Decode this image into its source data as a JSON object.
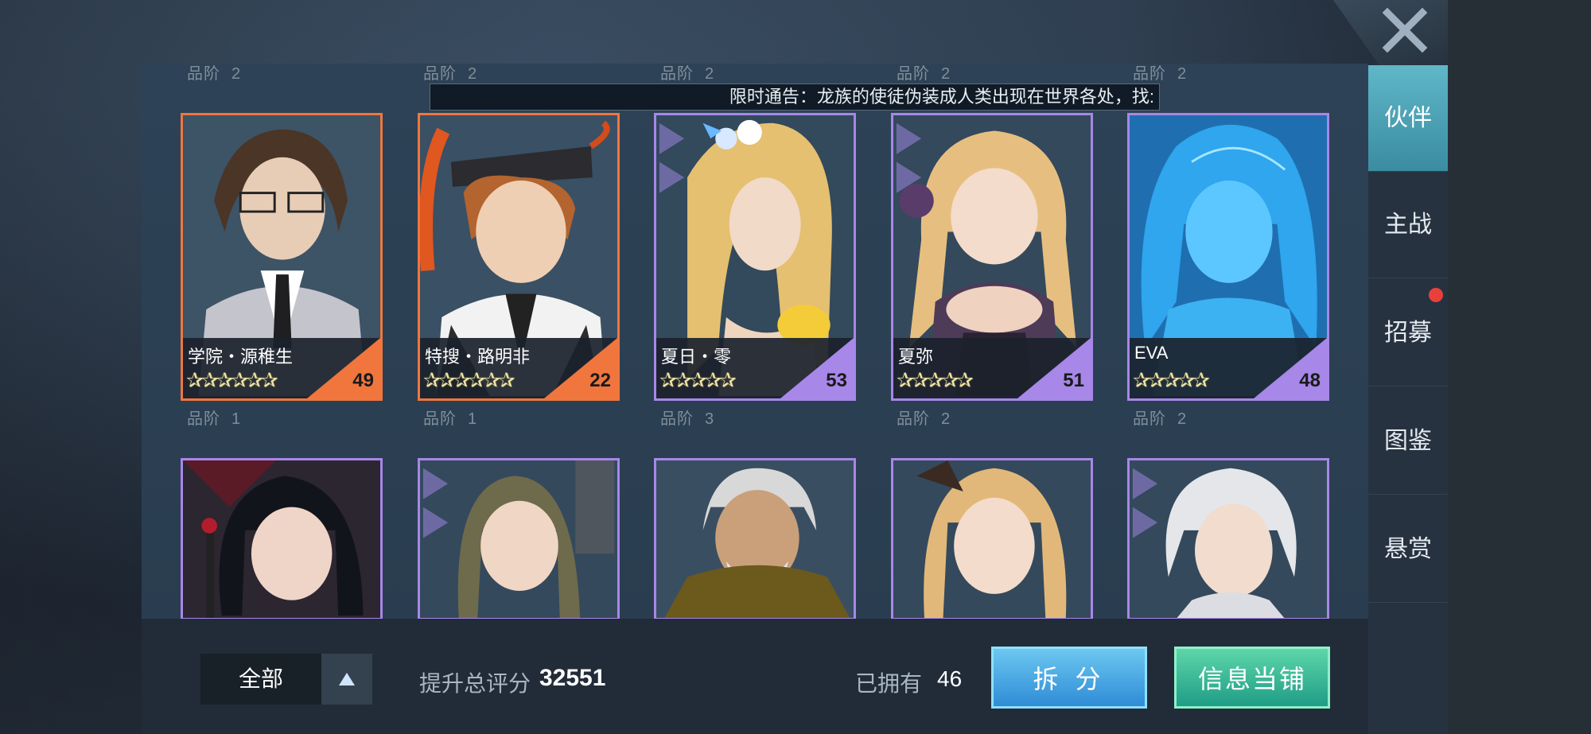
{
  "announcement": "限时通告：龙族的使徒伪装成人类出现在世界各处，找:",
  "grade_label": "品阶",
  "row0_grades": [
    "2",
    "2",
    "2",
    "2",
    "2"
  ],
  "row1_grades": [
    "1",
    "1",
    "3",
    "2",
    "2"
  ],
  "cards": [
    {
      "name": "学院・源稚生",
      "level": "49",
      "rarity": "orange",
      "stars": "✰✰✰✰✰✰"
    },
    {
      "name": "特搜・路明非",
      "level": "22",
      "rarity": "orange",
      "stars": "✰✰✰✰✰✰"
    },
    {
      "name": "夏日・零",
      "level": "53",
      "rarity": "purple",
      "stars": "✰✰✰✰✰"
    },
    {
      "name": "夏弥",
      "level": "51",
      "rarity": "purple",
      "stars": "✰✰✰✰✰"
    },
    {
      "name": "EVA",
      "level": "48",
      "rarity": "purple",
      "stars": "✰✰✰✰✰"
    }
  ],
  "sidebar": {
    "items": [
      {
        "label": "伙伴",
        "active": true
      },
      {
        "label": "主战"
      },
      {
        "label": "招募",
        "badge": true
      },
      {
        "label": "图鉴"
      },
      {
        "label": "悬赏"
      }
    ]
  },
  "bottom": {
    "filter_label": "全部",
    "score_label": "提升总评分",
    "score_value": "32551",
    "owned_label": "已拥有",
    "owned_value": "46",
    "split_button": "拆 分",
    "pawn_button": "信息当铺"
  },
  "colors": {
    "orange": "#f0763e",
    "purple": "#a787e8",
    "accent": "#5fb7c8"
  }
}
